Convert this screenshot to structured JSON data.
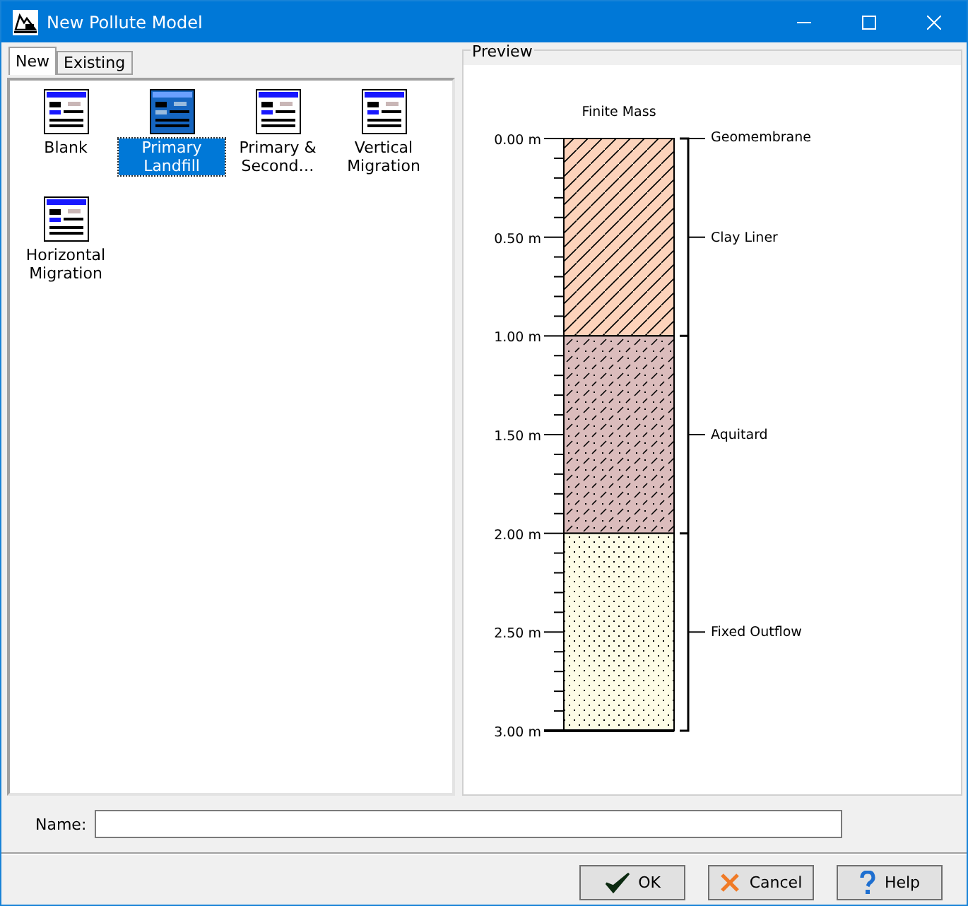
{
  "window": {
    "title": "New Pollute Model"
  },
  "tabs": [
    {
      "label": "New",
      "selected": true
    },
    {
      "label": "Existing",
      "selected": false
    }
  ],
  "templates": [
    {
      "label": "Blank",
      "selected": false
    },
    {
      "label": "Primary Landfill",
      "selected": true
    },
    {
      "label": "Primary & Second…",
      "selected": false
    },
    {
      "label": "Vertical Migration",
      "selected": false
    },
    {
      "label": "Horizontal Migration",
      "selected": false
    }
  ],
  "preview": {
    "title": "Preview",
    "column_title": "Finite Mass",
    "depth_labels": [
      "0.00 m",
      "0.50 m",
      "1.00 m",
      "1.50 m",
      "2.00 m",
      "2.50 m",
      "3.00 m"
    ],
    "layers": [
      {
        "label": "Geomembrane",
        "kind": "membrane"
      },
      {
        "label": "Clay Liner",
        "kind": "hatch",
        "color": "#fdd3bb"
      },
      {
        "label": "Aquitard",
        "kind": "dashes",
        "color": "#dbbcbc"
      },
      {
        "label": "Fixed Outflow",
        "kind": "dots",
        "color": "#fdfce6"
      }
    ]
  },
  "name_field": {
    "label": "Name:"
  },
  "buttons": [
    {
      "label": "OK",
      "kind": "ok"
    },
    {
      "label": "Cancel",
      "kind": "cancel"
    },
    {
      "label": "Help",
      "kind": "help"
    }
  ]
}
